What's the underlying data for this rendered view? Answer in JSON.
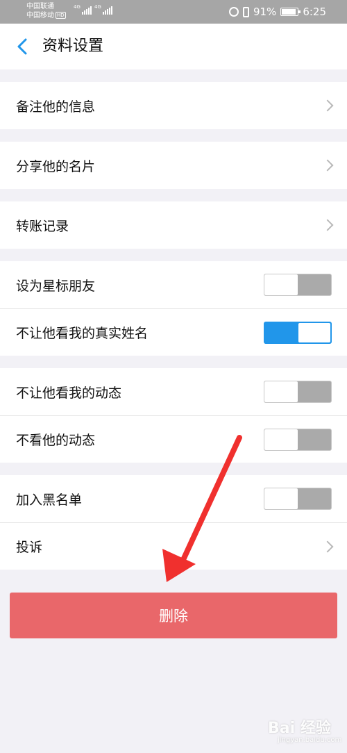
{
  "status_bar": {
    "carrier_1": "中国联通",
    "carrier_2": "中国移动",
    "hd_badge": "HD",
    "network_type": "4G",
    "battery_percent": "91%",
    "time": "6:25",
    "icons": [
      "signal-icon",
      "alarm-icon",
      "vibrate-icon",
      "battery-icon"
    ]
  },
  "navbar": {
    "back_icon": "chevron-left-icon",
    "title": "资料设置",
    "accent_color": "#2196ea"
  },
  "groups": [
    {
      "items": [
        {
          "label": "备注他的信息",
          "control": "chevron"
        }
      ]
    },
    {
      "items": [
        {
          "label": "分享他的名片",
          "control": "chevron"
        }
      ]
    },
    {
      "items": [
        {
          "label": "转账记录",
          "control": "chevron"
        }
      ]
    },
    {
      "items": [
        {
          "label": "设为星标朋友",
          "control": "toggle",
          "on": false
        },
        {
          "label": "不让他看我的真实姓名",
          "control": "toggle",
          "on": true
        }
      ]
    },
    {
      "items": [
        {
          "label": "不让他看我的动态",
          "control": "toggle",
          "on": false
        },
        {
          "label": "不看他的动态",
          "control": "toggle",
          "on": false
        }
      ]
    },
    {
      "items": [
        {
          "label": "加入黑名单",
          "control": "toggle",
          "on": false
        },
        {
          "label": "投诉",
          "control": "chevron"
        }
      ]
    }
  ],
  "delete_button": {
    "label": "删除",
    "color": "#e9676a"
  },
  "annotation": {
    "arrow_color": "#f0302e"
  },
  "watermark": {
    "text": "Bai 经验",
    "sub": "jingyan.baidu.com"
  }
}
